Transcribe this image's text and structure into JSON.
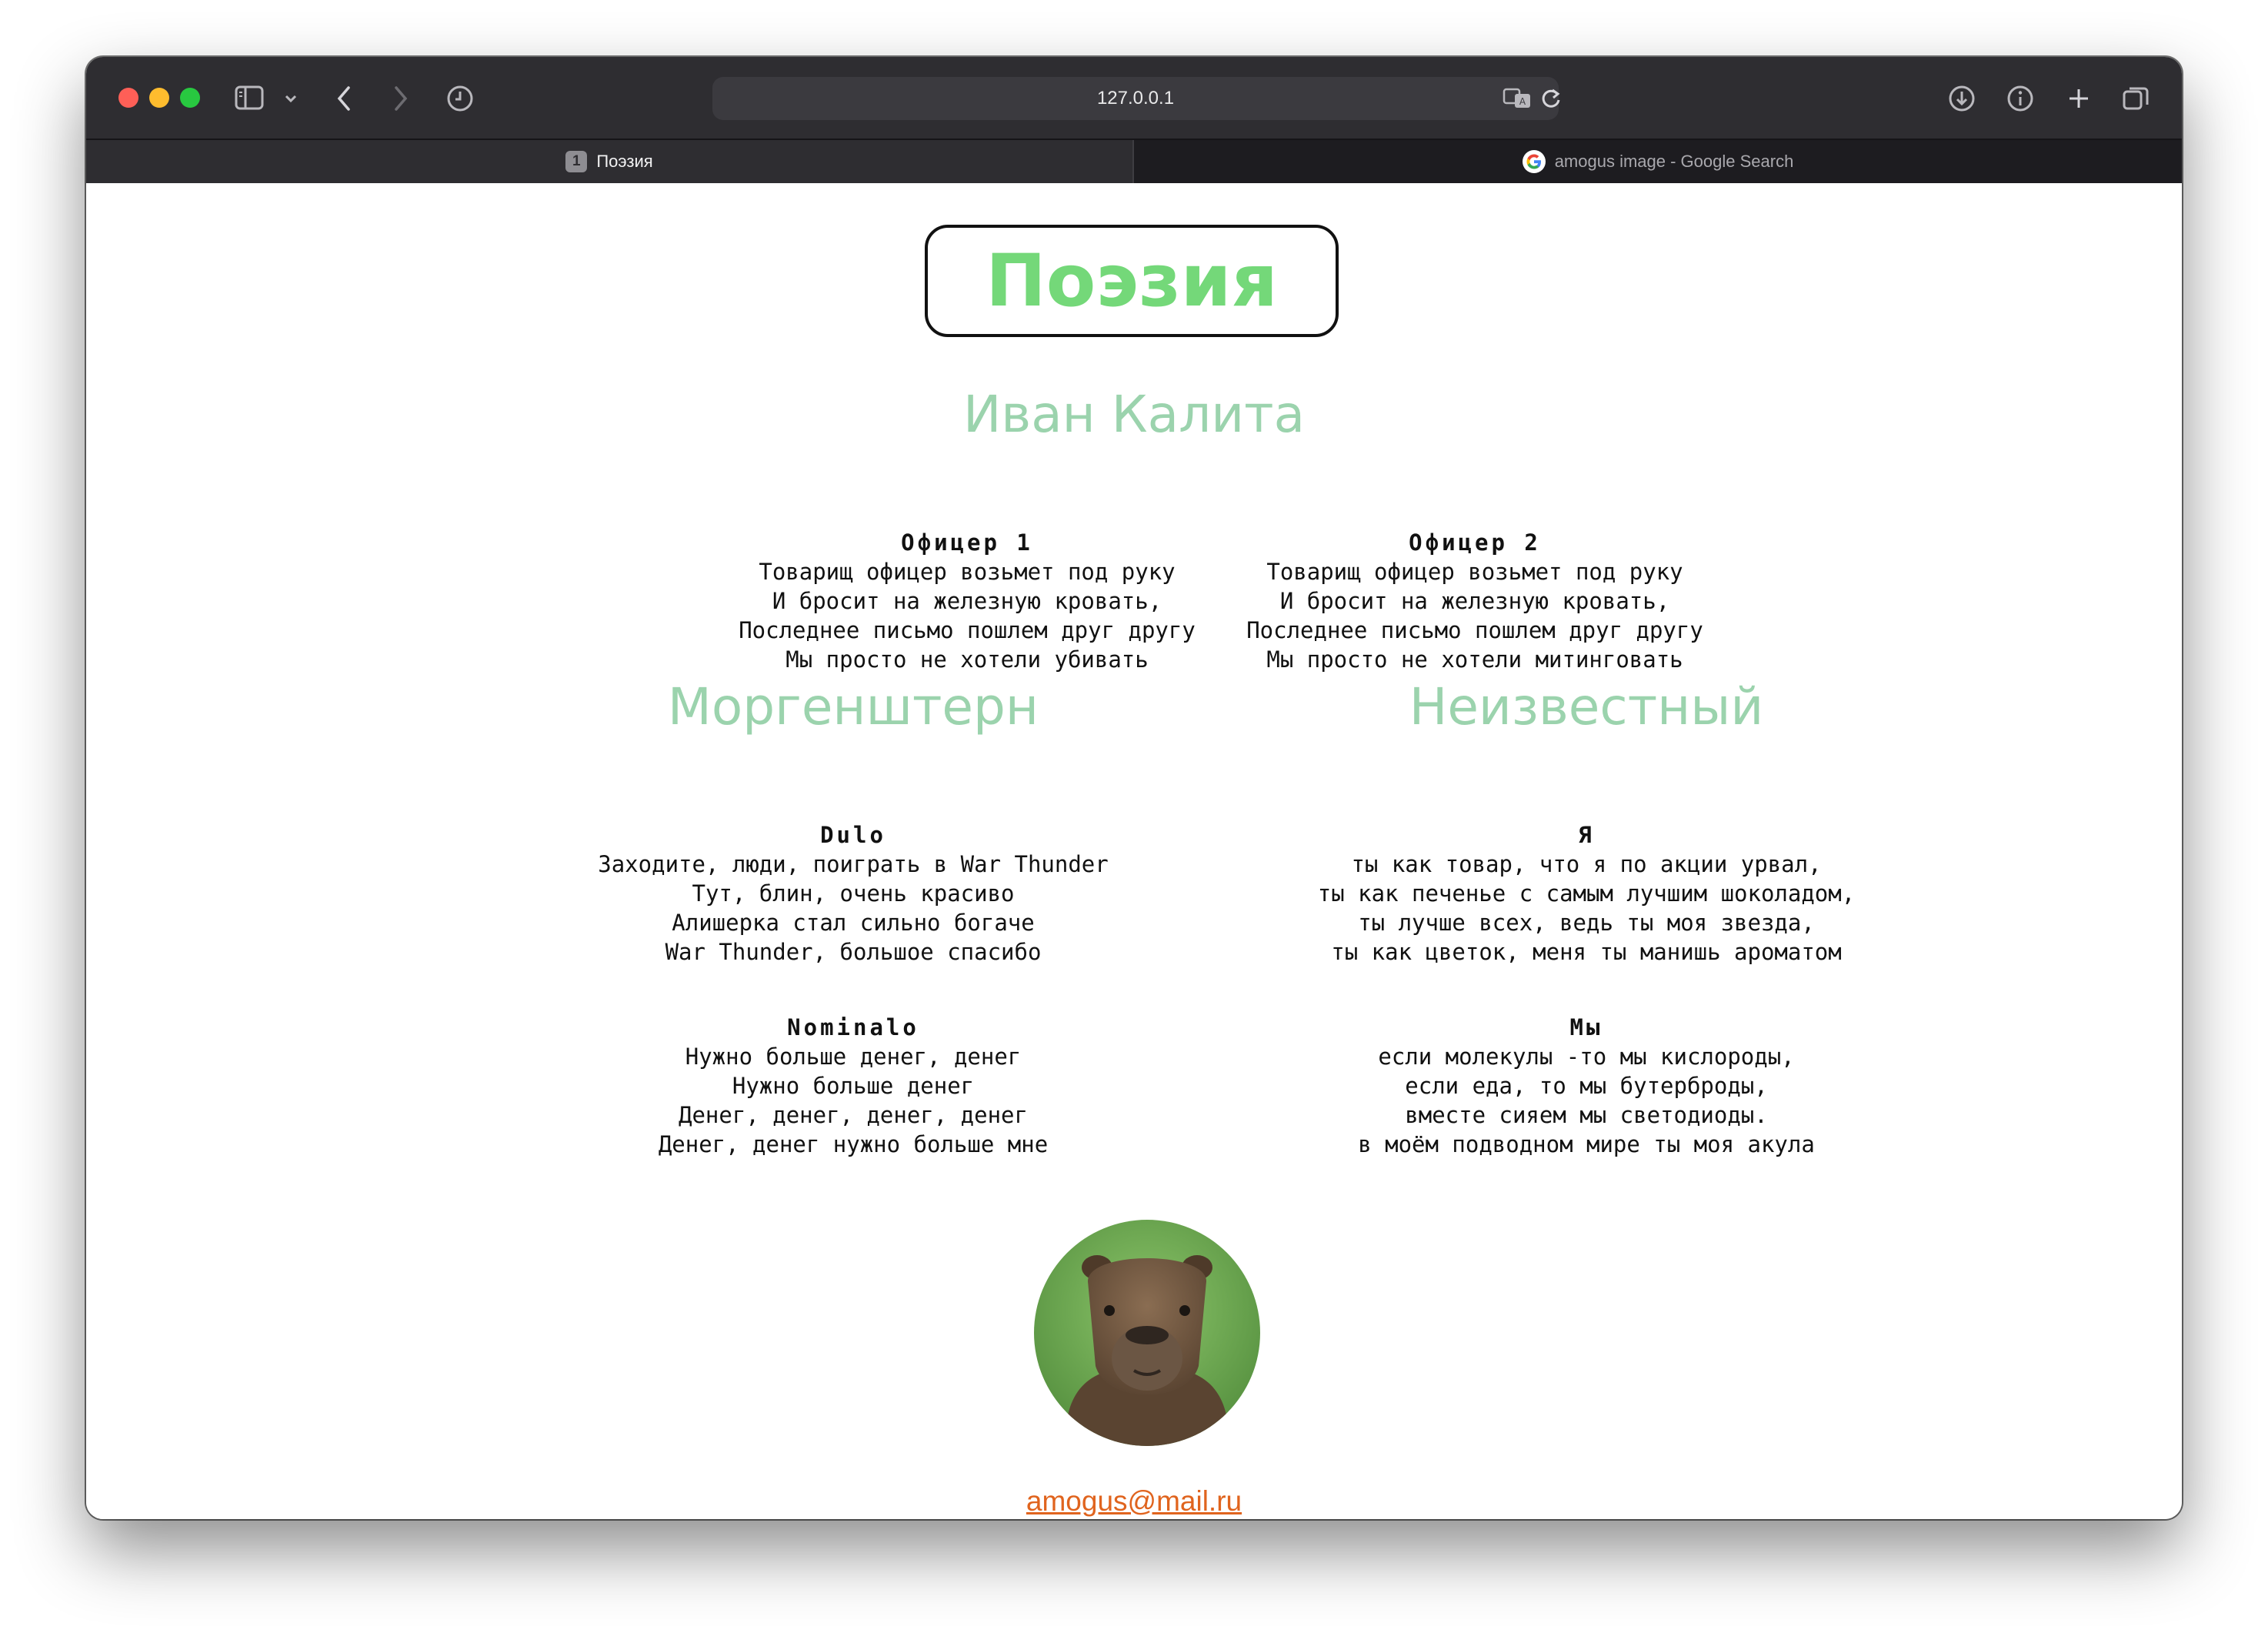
{
  "browser": {
    "url": "127.0.0.1",
    "tabs": [
      {
        "badge": "1",
        "label": "Поэзия",
        "active": true
      },
      {
        "label": "amogus image - Google Search",
        "active": false
      }
    ]
  },
  "page": {
    "title": "Поэзия",
    "sections": [
      {
        "author": "Иван Калита",
        "poems": [
          {
            "title": "Офицер 1",
            "lines": [
              "Товарищ офицер возьмет под руку",
              "И бросит на железную кровать,",
              "Последнее письмо пошлем друг другу",
              "Мы просто не хотели убивать"
            ]
          },
          {
            "title": "Офицер 2",
            "lines": [
              "Товарищ офицер возьмет под руку",
              "И бросит на железную кровать,",
              "Последнее письмо пошлем друг другу",
              "Мы просто не хотели митинговать"
            ]
          }
        ]
      },
      {
        "author": "Моргенштерн",
        "poems": [
          {
            "title": "Dulo",
            "lines": [
              "Заходите, люди, поиграть в War Thunder",
              "Тут, блин, очень красиво",
              "Алишерка стал сильно богаче",
              "War Thunder, большое спасибо"
            ]
          },
          {
            "title": "Nominalo",
            "lines": [
              "Нужно больше денег, денег",
              "Нужно больше денег",
              "Денег, денег, денег, денег",
              "Денег, денег нужно больше мне"
            ]
          }
        ]
      },
      {
        "author": "Неизвестный",
        "poems": [
          {
            "title": "Я",
            "lines": [
              "ты как товар, что я по акции урвал,",
              "ты как печенье с самым лучшим шоколадом,",
              "ты лучше всех, ведь ты моя звезда,",
              "ты как цветок, меня ты манишь ароматом"
            ]
          },
          {
            "title": "Мы",
            "lines": [
              "если молекулы -то мы кислороды,",
              "если еда, то мы бутерброды,",
              "вместе сияем мы светодиоды.",
              "в моём подводном мире ты моя акула"
            ]
          }
        ]
      }
    ],
    "email": "amogus@mail.ru"
  },
  "colors": {
    "title": "#74d879",
    "author": "#9bd3ad",
    "link": "#e0641e",
    "toolbar": "#2e2d31"
  }
}
